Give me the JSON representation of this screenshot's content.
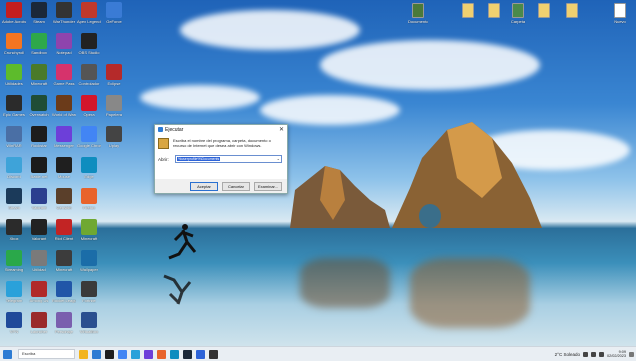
{
  "run_dialog": {
    "title": "Ejecutar",
    "description": "Escriba el nombre del programa, carpeta, documento o recurso de Internet que desea abrir con Windows.",
    "open_label": "Abrir:",
    "open_value": "%userprofile%\\Documents",
    "ok_label": "Aceptar",
    "cancel_label": "Cancelar",
    "browse_label": "Examinar..."
  },
  "desktop_icons_left": [
    {
      "label": "Adobe Acrobat",
      "color": "#c41e1e"
    },
    {
      "label": "Steam",
      "color": "#1b2838"
    },
    {
      "label": "WarThunder",
      "color": "#333"
    },
    {
      "label": "Apex Legends",
      "color": "#c0392b"
    },
    {
      "label": "GeForce",
      "color": "#3a7bd5"
    },
    {
      "label": "Crunchyroll",
      "color": "#f47521"
    },
    {
      "label": "Sandbox",
      "color": "#2ea84a"
    },
    {
      "label": "Notepad",
      "color": "#8e44ad"
    },
    {
      "label": "OBS Studio",
      "color": "#222"
    },
    {
      "label": "",
      "color": ""
    },
    {
      "label": "Utilidades",
      "color": "#5dbb2c"
    },
    {
      "label": "Minecraft",
      "color": "#4a7a2a"
    },
    {
      "label": "Game Pass",
      "color": "#d6336c"
    },
    {
      "label": "Controlador",
      "color": "#555"
    },
    {
      "label": "Eclipse",
      "color": "#b52a2a"
    },
    {
      "label": "Epic Games",
      "color": "#2b2b2b"
    },
    {
      "label": "Overwatch",
      "color": "#1f4d36"
    },
    {
      "label": "World of Warcraft",
      "color": "#6b3b1a"
    },
    {
      "label": "Opera",
      "color": "#d3162b"
    },
    {
      "label": "Papelera",
      "color": "#888"
    },
    {
      "label": "WinRAR",
      "color": "#4a6fa5"
    },
    {
      "label": "Rockstar",
      "color": "#1d1d1d"
    },
    {
      "label": "Messenger",
      "color": "#6d3fd9"
    },
    {
      "label": "Google Chrome",
      "color": "#4285f4"
    },
    {
      "label": "Uplay",
      "color": "#444"
    },
    {
      "label": "Discord",
      "color": "#3ea3d9"
    },
    {
      "label": "Battle.net",
      "color": "#1b1b1b"
    },
    {
      "label": "Mouse",
      "color": "#1f1f1f"
    },
    {
      "label": "Edge",
      "color": "#0f8dbf"
    },
    {
      "label": "",
      "color": ""
    },
    {
      "label": "Steam",
      "color": "#1b3a5a"
    },
    {
      "label": "Valorant",
      "color": "#2b3f8f"
    },
    {
      "label": "Genshin",
      "color": "#5a3f2a"
    },
    {
      "label": "Firefox",
      "color": "#e8632b"
    },
    {
      "label": "",
      "color": ""
    },
    {
      "label": "Xbox",
      "color": "#2b2b2b"
    },
    {
      "label": "Valorant",
      "color": "#222"
    },
    {
      "label": "Riot Client",
      "color": "#c22424"
    },
    {
      "label": "Minecraft",
      "color": "#6fa832"
    },
    {
      "label": "",
      "color": ""
    },
    {
      "label": "Streaming",
      "color": "#2aa84a"
    },
    {
      "label": "Utilidad",
      "color": "#7a7a7a"
    },
    {
      "label": "Minecraft",
      "color": "#3c3c3c"
    },
    {
      "label": "Wallpaper",
      "color": "#1b6da8"
    },
    {
      "label": "",
      "color": ""
    },
    {
      "label": "Telegram",
      "color": "#2aa1da"
    },
    {
      "label": "Among Us",
      "color": "#b02a2a"
    },
    {
      "label": "Rocket League",
      "color": "#2156a8"
    },
    {
      "label": "Fortnite",
      "color": "#3a3a3a"
    },
    {
      "label": "",
      "color": ""
    },
    {
      "label": "VPN",
      "color": "#1f4a9a"
    },
    {
      "label": "Launcher",
      "color": "#9a2a2a"
    },
    {
      "label": "Personaje",
      "color": "#7a5fae"
    },
    {
      "label": "VirtualBox",
      "color": "#2a4f8f"
    }
  ],
  "desktop_icons_right": [
    {
      "label": "Documento",
      "color": "#4a7a3a"
    },
    {
      "label": "",
      "color": "#f0d070"
    },
    {
      "label": "",
      "color": "#f0d070"
    },
    {
      "label": "Carpeta",
      "color": "#4a8a4a"
    },
    {
      "label": "",
      "color": "#f0d070"
    },
    {
      "label": "",
      "color": "#f0d070"
    },
    {
      "label": "Nuevo",
      "color": "#ffffff"
    }
  ],
  "taskbar": {
    "search_placeholder": "Escriba",
    "weather": "2°C Soleado",
    "time": "9:09",
    "date": "02/02/2023",
    "apps": [
      "#f2b41c",
      "#2d7bd3",
      "#1e1e1e",
      "#4285f4",
      "#2aa1da",
      "#6d3fd9",
      "#e8632b",
      "#0f8dbf",
      "#1b2838",
      "#2d63d8",
      "#333333"
    ]
  }
}
